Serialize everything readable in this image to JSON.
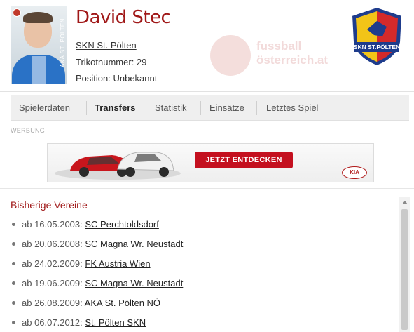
{
  "player": {
    "name": "David Stec",
    "club": "SKN St. Pölten",
    "jersey": "Trikotnummer: 29",
    "position": "Position: Unbekannt",
    "photo_caption": "AKA ST. PÖLTEN"
  },
  "branding": {
    "watermark": "fussball\nösterreich.at",
    "crest_text": "SKN ST.PÖLTEN",
    "accent_color": "#a01818",
    "crest_colors": [
      "#1e3c8c",
      "#f2c418",
      "#d42a2a"
    ]
  },
  "tabs": [
    {
      "label": "Spielerdaten",
      "active": false
    },
    {
      "label": "Transfers",
      "active": true
    },
    {
      "label": "Statistik",
      "active": false
    },
    {
      "label": "Einsätze",
      "active": false
    },
    {
      "label": "Letztes Spiel",
      "active": false
    }
  ],
  "ad": {
    "label": "WERBUNG",
    "cta": "JETZT ENTDECKEN",
    "brand": "KIA"
  },
  "transfers": {
    "title": "Bisherige Vereine",
    "items": [
      {
        "date": "ab 16.05.2003:",
        "club": "SC Perchtoldsdorf"
      },
      {
        "date": "ab 20.06.2008:",
        "club": "SC Magna Wr. Neustadt"
      },
      {
        "date": "ab 24.02.2009:",
        "club": "FK Austria Wien"
      },
      {
        "date": "ab 19.06.2009:",
        "club": "SC Magna Wr. Neustadt"
      },
      {
        "date": "ab 26.08.2009:",
        "club": "AKA St. Pölten NÖ"
      },
      {
        "date": "ab 06.07.2012:",
        "club": "St. Pölten SKN"
      }
    ]
  }
}
